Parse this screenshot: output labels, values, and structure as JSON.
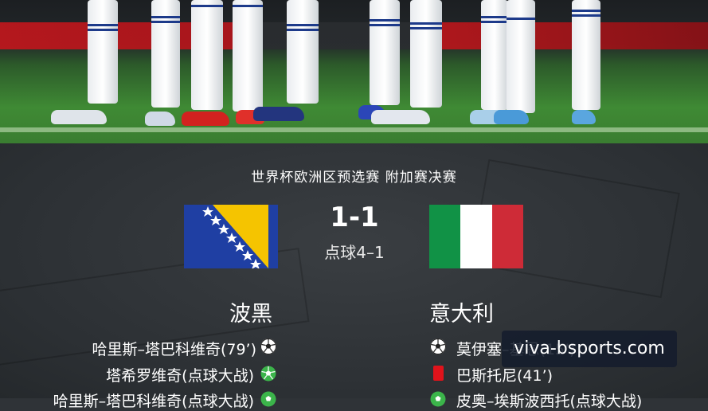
{
  "match": {
    "competition": "世界杯欧洲区预选赛 附加赛决赛",
    "score": "1-1",
    "penalties": "点球4–1"
  },
  "home": {
    "name": "波黑",
    "flag_icon": "bosnia-flag-icon",
    "events": [
      {
        "text": "哈里斯–塔巴科维奇(79’)",
        "icon": "soccer-ball-icon"
      },
      {
        "text": "塔希罗维奇(点球大战)",
        "icon": "penalty-goal-icon"
      },
      {
        "text": "哈里斯–塔巴科维奇(点球大战)",
        "icon": "penalty-goal-icon"
      }
    ]
  },
  "away": {
    "name": "意大利",
    "flag_icon": "italy-flag-icon",
    "events": [
      {
        "text": "莫伊塞–基恩(15’)",
        "icon": "soccer-ball-icon"
      },
      {
        "text": "巴斯托尼(41’)",
        "icon": "red-card-icon"
      },
      {
        "text": "皮奥–埃斯波西托(点球大战)",
        "icon": "penalty-miss-icon"
      }
    ]
  },
  "watermark": "viva-bsports.com",
  "colors": {
    "panel_bg": "#2f3337",
    "bosnia_blue": "#1f3fa3",
    "bosnia_yellow": "#f5c400",
    "italy_green": "#119246",
    "italy_white": "#ffffff",
    "italy_red": "#ce2b37",
    "penalty_green": "#3bb44a",
    "red_card": "#e0131b"
  }
}
